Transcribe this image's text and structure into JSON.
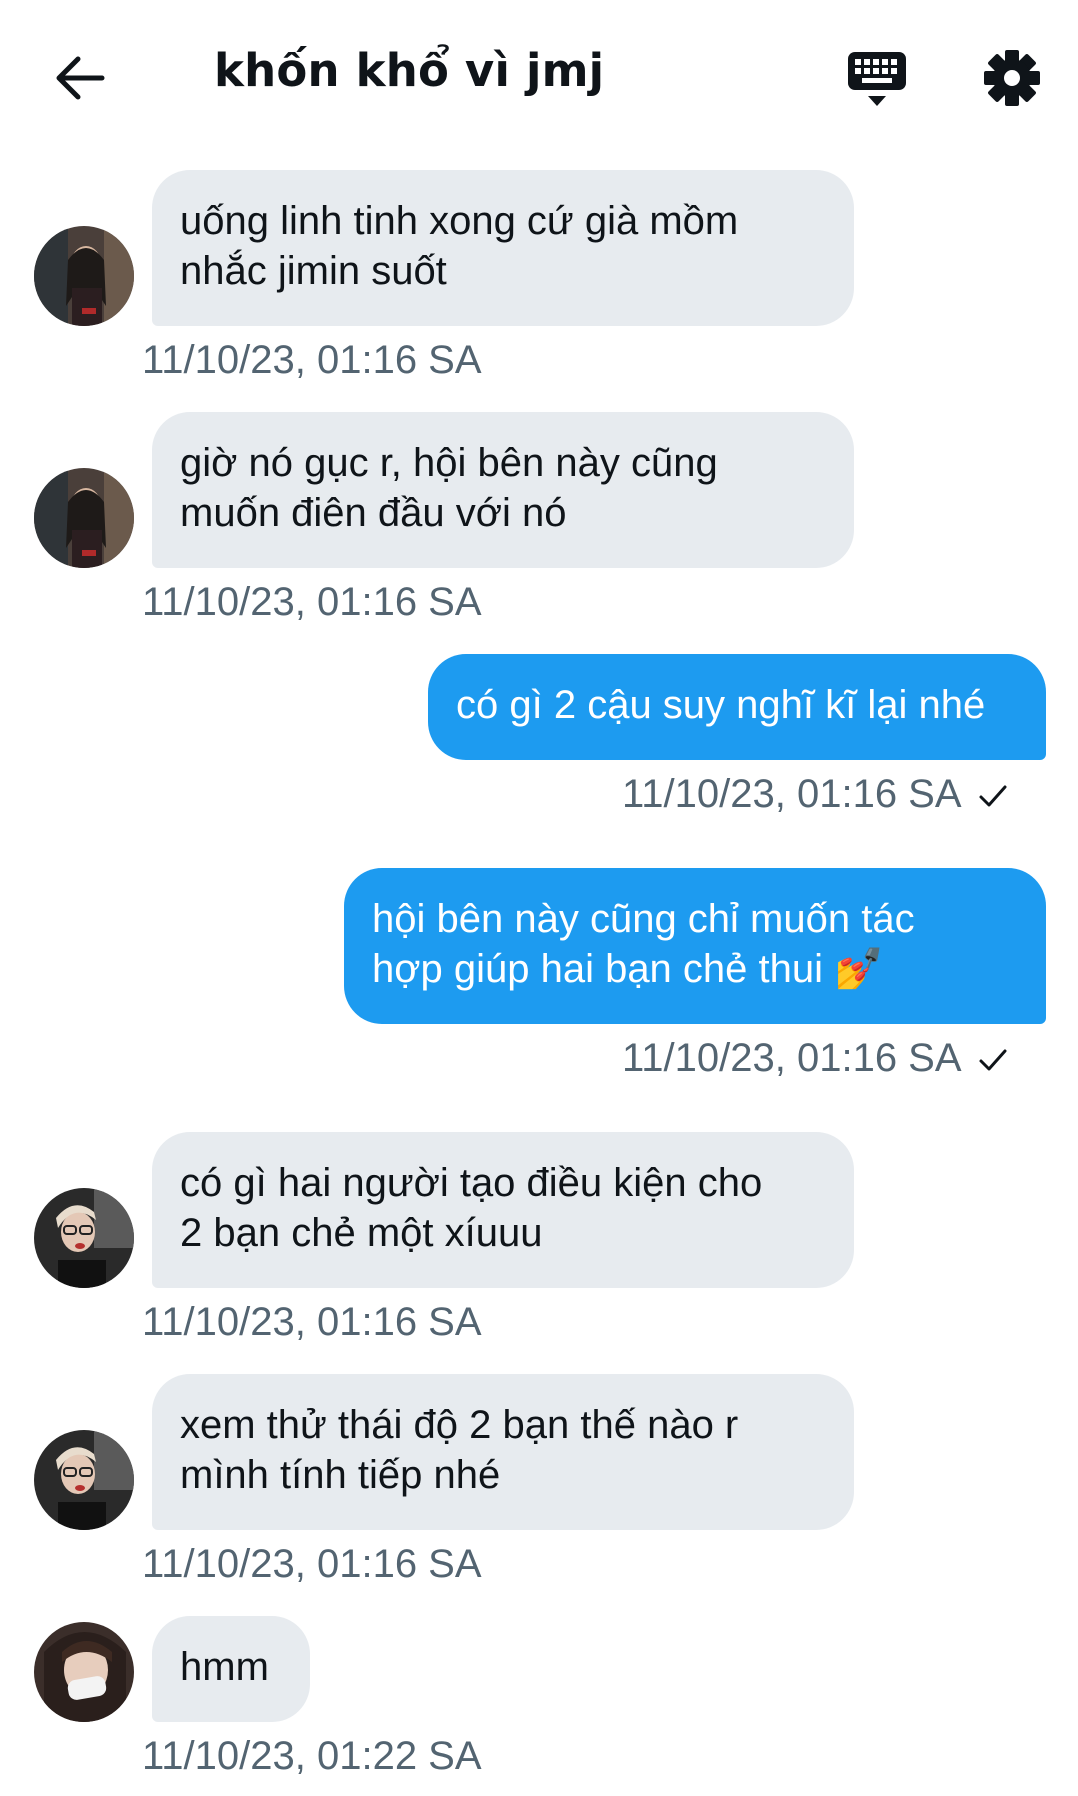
{
  "header": {
    "title": "khốn khổ vì jmj",
    "back_icon": "arrow-left-icon",
    "keyboard_icon": "keyboard-icon",
    "settings_icon": "gear-icon"
  },
  "messages": [
    {
      "direction": "in",
      "avatar": "avatar-user-a",
      "text": "uống linh tinh xong cứ già mồm nhắc jimin suốt",
      "line1": "uống linh tinh xong cứ già mồm",
      "line2": "nhắc jimin suốt",
      "time": "11/10/23, 01:16 SA"
    },
    {
      "direction": "in",
      "avatar": "avatar-user-a",
      "text": "giờ nó gục r, hội bên này cũng muốn điên đầu với nó",
      "line1": "giờ nó gục r, hội bên này cũng",
      "line2": "muốn điên đầu với nó",
      "time": "11/10/23, 01:16 SA"
    },
    {
      "direction": "out",
      "text": "có gì 2 cậu suy nghĩ kĩ lại nhé",
      "line1": "có gì 2 cậu suy nghĩ kĩ lại nhé",
      "time": "11/10/23, 01:16 SA",
      "status": "check-icon"
    },
    {
      "direction": "out",
      "text": "hội bên này cũng chỉ muốn tác hợp giúp hai bạn chẻ thui 💅",
      "line1": "hội bên này cũng chỉ muốn tác",
      "line2": "hợp giúp hai bạn chẻ thui",
      "emoji": "💅",
      "time": "11/10/23, 01:16 SA",
      "status": "check-icon"
    },
    {
      "direction": "in",
      "avatar": "avatar-user-b",
      "text": "có gì hai người tạo điều kiện cho 2 bạn chẻ một xíuuu",
      "line1": "có gì hai người tạo điều kiện cho",
      "line2": "2 bạn chẻ một xíuuu",
      "time": "11/10/23, 01:16 SA"
    },
    {
      "direction": "in",
      "avatar": "avatar-user-b",
      "text": "xem thử thái độ 2 bạn thế nào r mình tính tiếp nhé",
      "line1": "xem thử thái độ 2 bạn thế nào r",
      "line2": "mình tính tiếp nhé",
      "time": "11/10/23, 01:16 SA"
    },
    {
      "direction": "in",
      "avatar": "avatar-user-c",
      "text": "hmm",
      "line1": "hmm",
      "time": "11/10/23, 01:22 SA"
    }
  ],
  "colors": {
    "incoming_bubble": "#e7ebef",
    "outgoing_bubble": "#1d9bf0",
    "timestamp": "#536471",
    "text": "#0f1419"
  }
}
